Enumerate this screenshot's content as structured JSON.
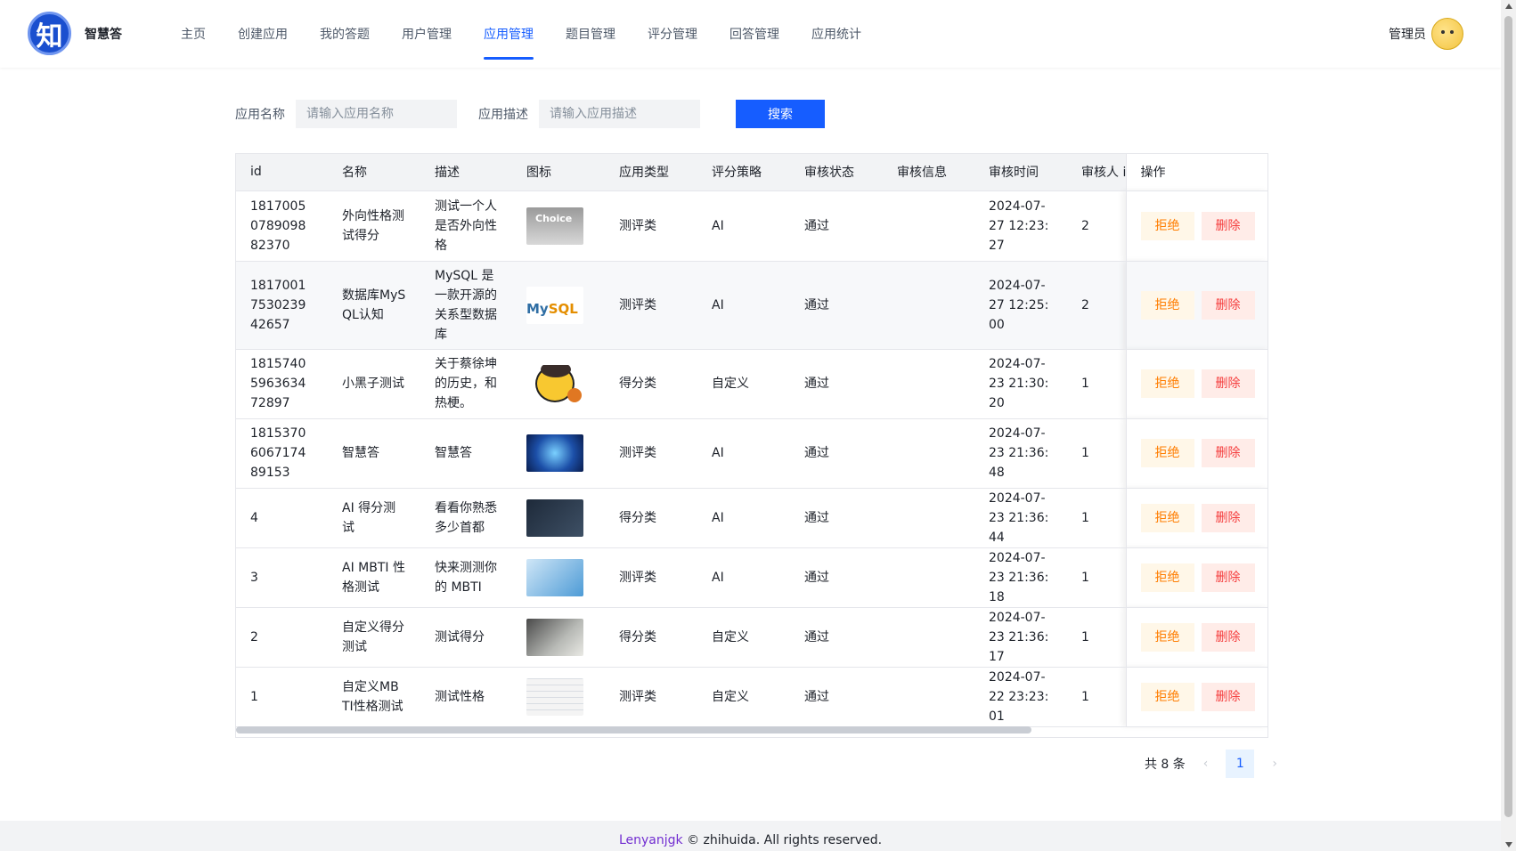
{
  "header": {
    "logo_text": "知",
    "brand": "智慧答",
    "nav": [
      {
        "label": "主页",
        "active": false
      },
      {
        "label": "创建应用",
        "active": false
      },
      {
        "label": "我的答题",
        "active": false
      },
      {
        "label": "用户管理",
        "active": false
      },
      {
        "label": "应用管理",
        "active": true
      },
      {
        "label": "题目管理",
        "active": false
      },
      {
        "label": "评分管理",
        "active": false
      },
      {
        "label": "回答管理",
        "active": false
      },
      {
        "label": "应用统计",
        "active": false
      }
    ],
    "user_name": "管理员"
  },
  "search": {
    "name_label": "应用名称",
    "name_placeholder": "请输入应用名称",
    "desc_label": "应用描述",
    "desc_placeholder": "请输入应用描述",
    "button": "搜索"
  },
  "table": {
    "columns": [
      "id",
      "名称",
      "描述",
      "图标",
      "应用类型",
      "评分策略",
      "审核状态",
      "审核信息",
      "审核时间",
      "审核人 i",
      "操作"
    ],
    "rows": [
      {
        "id": "1817005078909882370",
        "name": "外向性格测试得分",
        "desc": "测试一个人是否外向性格",
        "icon": "choice-image",
        "type": "测评类",
        "strategy": "AI",
        "status": "通过",
        "info": "",
        "time": "2024-07-27 12:23:27",
        "reviewer": "2"
      },
      {
        "id": "1817001753023942657",
        "name": "数据库MySQL认知",
        "desc": "MySQL 是一款开源的关系型数据库",
        "icon": "mysql-logo",
        "type": "测评类",
        "strategy": "AI",
        "status": "通过",
        "info": "",
        "time": "2024-07-27 12:25:00",
        "reviewer": "2"
      },
      {
        "id": "1815740596363472897",
        "name": "小黑子测试",
        "desc": "关于蔡徐坤的历史，和热梗。",
        "icon": "cartoon-image",
        "type": "得分类",
        "strategy": "自定义",
        "status": "通过",
        "info": "",
        "time": "2024-07-23 21:30:20",
        "reviewer": "1"
      },
      {
        "id": "1815370606717489153",
        "name": "智慧答",
        "desc": "智慧答",
        "icon": "tech-image",
        "type": "测评类",
        "strategy": "AI",
        "status": "通过",
        "info": "",
        "time": "2024-07-23 21:36:48",
        "reviewer": "1"
      },
      {
        "id": "4",
        "name": "AI 得分测试",
        "desc": "看看你熟悉多少首都",
        "icon": "dark-image",
        "type": "得分类",
        "strategy": "AI",
        "status": "通过",
        "info": "",
        "time": "2024-07-23 21:36:44",
        "reviewer": "1"
      },
      {
        "id": "3",
        "name": "AI MBTI 性格测试",
        "desc": "快来测测你的 MBTI",
        "icon": "blue-image",
        "type": "测评类",
        "strategy": "AI",
        "status": "通过",
        "info": "",
        "time": "2024-07-23 21:36:18",
        "reviewer": "1"
      },
      {
        "id": "2",
        "name": "自定义得分测试",
        "desc": "测试得分",
        "icon": "paper-image",
        "type": "得分类",
        "strategy": "自定义",
        "status": "通过",
        "info": "",
        "time": "2024-07-23 21:36:17",
        "reviewer": "1"
      },
      {
        "id": "1",
        "name": "自定义MBTI性格测试",
        "desc": "测试性格",
        "icon": "sheet-image",
        "type": "测评类",
        "strategy": "自定义",
        "status": "通过",
        "info": "",
        "time": "2024-07-22 23:23:01",
        "reviewer": "1"
      }
    ],
    "reject_label": "拒绝",
    "delete_label": "删除"
  },
  "pagination": {
    "total": "共 8 条",
    "current": "1"
  },
  "footer": {
    "author": "Lenyanjgk",
    "text": " © zhihuida. All rights reserved."
  },
  "colors": {
    "primary": "#165dff",
    "reject": "#ff7d00",
    "delete": "#f53f3f"
  }
}
